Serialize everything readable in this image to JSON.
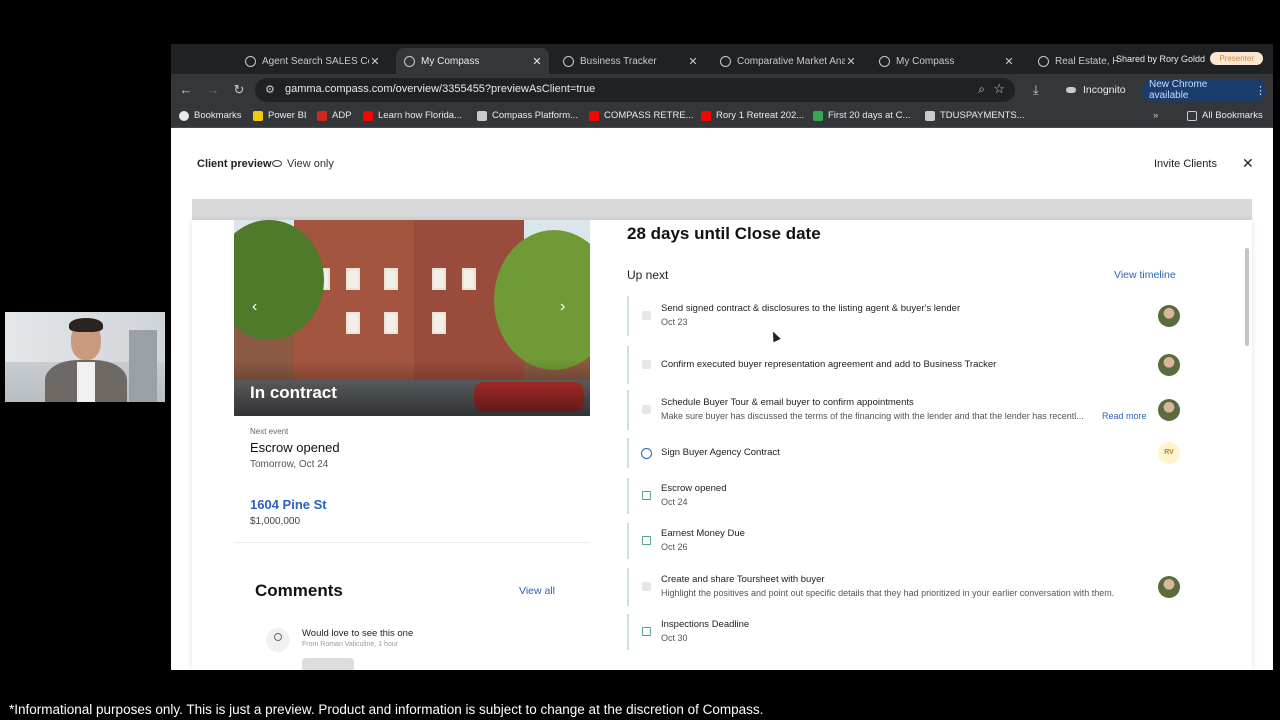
{
  "browser": {
    "tabs": [
      {
        "title": "Agent Search SALES Co"
      },
      {
        "title": "My Compass"
      },
      {
        "title": "Business Tracker"
      },
      {
        "title": "Comparative Market Ana"
      },
      {
        "title": "My Compass"
      },
      {
        "title": "Real Estate, H"
      }
    ],
    "shared_by": "Shared by Rory Goldd",
    "presenter_badge": "Presenter",
    "url": "gamma.compass.com/overview/3355455?previewAsClient=true",
    "incognito_label": "Incognito",
    "new_chrome_label": "New Chrome available",
    "bookmarks": [
      {
        "label": "Bookmarks",
        "color": "#e8eaed"
      },
      {
        "label": "Power BI",
        "color": "#f2c811"
      },
      {
        "label": "ADP",
        "color": "#d0271d"
      },
      {
        "label": "Learn how Florida...",
        "color": "#ff0000"
      },
      {
        "label": "Compass Platform...",
        "color": "#c8cacd"
      },
      {
        "label": "COMPASS RETRE...",
        "color": "#ff0000"
      },
      {
        "label": "Rory 1 Retreat 202...",
        "color": "#ff0000"
      },
      {
        "label": "First 20 days at C...",
        "color": "#34a853"
      },
      {
        "label": "TDUSPAYMENTS...",
        "color": "#c8cacd"
      }
    ],
    "all_bookmarks": "All Bookmarks"
  },
  "header": {
    "preview_label": "Client preview",
    "view_only": "View only",
    "invite_clients": "Invite Clients"
  },
  "listing": {
    "status": "In contract",
    "next_event_label": "Next event",
    "next_event": "Escrow opened",
    "next_event_date": "Tomorrow, Oct 24",
    "address": "1604 Pine St",
    "price": "$1,000,000"
  },
  "comments": {
    "title": "Comments",
    "view_all": "View all",
    "items": [
      {
        "text": "Would love to see this one",
        "from": "From Roman Valiculine, 1 hour"
      }
    ]
  },
  "timeline": {
    "countdown": "28 days until Close date",
    "up_next": "Up next",
    "view_timeline": "View timeline",
    "tasks": [
      {
        "title": "Send signed contract & disclosures to the listing agent & buyer's lender",
        "sub": "Oct 23",
        "marker": "check",
        "assignee": "avatar"
      },
      {
        "title": "Confirm executed buyer representation agreement and add to Business Tracker",
        "sub": "",
        "marker": "check",
        "assignee": "avatar"
      },
      {
        "title": "Schedule Buyer Tour & email buyer to confirm appointments",
        "sub": "Make sure buyer has discussed the terms of the financing with the lender and that the lender has recentl...",
        "read_more": "Read more",
        "marker": "check",
        "assignee": "avatar"
      },
      {
        "title": "Sign Buyer Agency Contract",
        "sub": "",
        "marker": "circle",
        "assignee": "RV"
      },
      {
        "title": "Escrow opened",
        "sub": "Oct 24",
        "marker": "calendar",
        "assignee": ""
      },
      {
        "title": "Earnest Money Due",
        "sub": "Oct 26",
        "marker": "calendar",
        "assignee": ""
      },
      {
        "title": "Create and share Toursheet with buyer",
        "sub": "Highlight the positives and point out specific details that they had prioritized in your earlier conversation with them.",
        "marker": "check",
        "assignee": "avatar"
      },
      {
        "title": "Inspections Deadline",
        "sub": "Oct 30",
        "marker": "calendar",
        "assignee": ""
      }
    ]
  },
  "footnote": "*Informational purposes only. This is just a preview. Product and information is subject to change at the discretion of Compass.",
  "icons": {
    "back": "arrow-left-icon",
    "forward": "arrow-right-icon",
    "reload": "reload-icon",
    "close": "close-icon"
  }
}
